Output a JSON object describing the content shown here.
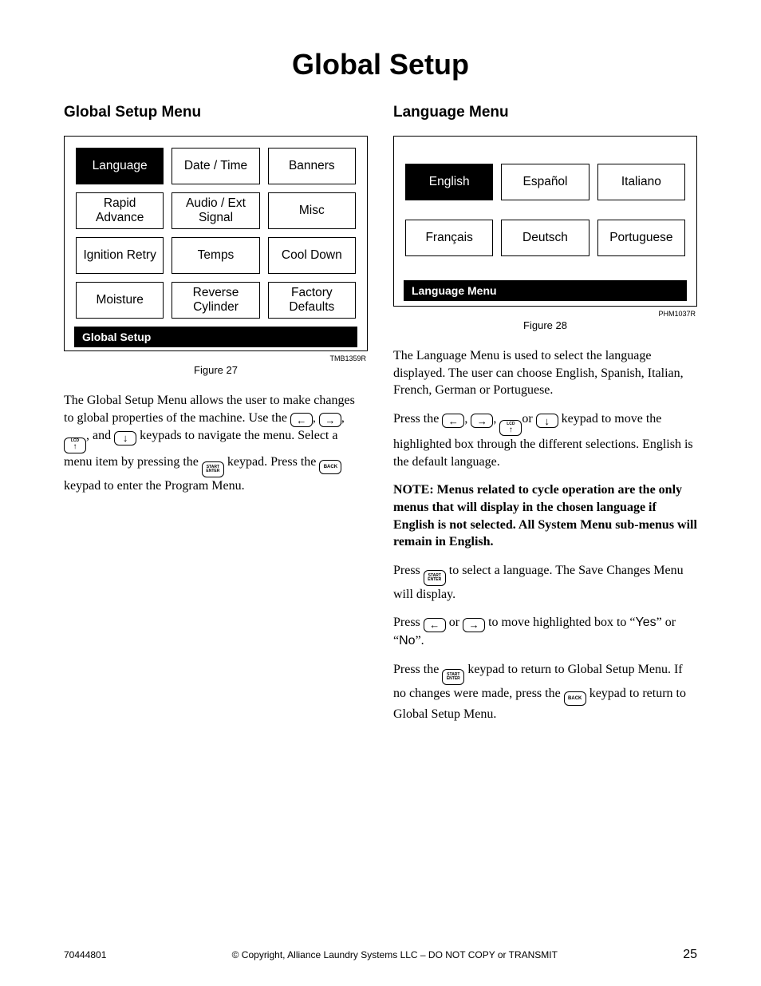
{
  "page_title": "Global Setup",
  "left": {
    "heading": "Global Setup Menu",
    "panel": {
      "cells": [
        {
          "label": "Language",
          "selected": true
        },
        {
          "label": "Date / Time",
          "selected": false
        },
        {
          "label": "Banners",
          "selected": false
        },
        {
          "label": "Rapid Advance",
          "selected": false
        },
        {
          "label": "Audio / Ext Signal",
          "selected": false
        },
        {
          "label": "Misc",
          "selected": false
        },
        {
          "label": "Ignition Retry",
          "selected": false
        },
        {
          "label": "Temps",
          "selected": false
        },
        {
          "label": "Cool Down",
          "selected": false
        },
        {
          "label": "Moisture",
          "selected": false
        },
        {
          "label": "Reverse Cylinder",
          "selected": false
        },
        {
          "label": "Factory Defaults",
          "selected": false
        }
      ],
      "titlebar": "Global Setup"
    },
    "imgcode": "TMB1359R",
    "figcaption": "Figure 27",
    "para1_a": "The Global Setup Menu allows the user to make changes to global properties of the machine. Use the ",
    "para1_b": ", ",
    "para1_c": ", ",
    "para1_d": ", and ",
    "para1_e": " keypads to navigate the menu. Select a menu item by pressing the ",
    "para1_f": " keypad. Press the ",
    "para1_g": " keypad to enter the Program Menu."
  },
  "right": {
    "heading": "Language Menu",
    "panel": {
      "cells": [
        {
          "label": "English",
          "selected": true
        },
        {
          "label": "Español",
          "selected": false
        },
        {
          "label": "Italiano",
          "selected": false
        },
        {
          "label": "Français",
          "selected": false
        },
        {
          "label": "Deutsch",
          "selected": false
        },
        {
          "label": "Portuguese",
          "selected": false
        }
      ],
      "titlebar": "Language Menu"
    },
    "imgcode": "PHM1037R",
    "figcaption": "Figure 28",
    "para1": "The Language Menu is used to select the language displayed. The user can choose English, Spanish, Italian, French, German or Portuguese.",
    "para2_a": "Press the ",
    "para2_b": ", ",
    "para2_c": ", ",
    "para2_d": "or ",
    "para2_e": " keypad to move the highlighted box through the different selections. English is the default language.",
    "note": "NOTE: Menus related to cycle operation are the only menus that will display in the chosen language if English is not selected. All System Menu sub-menus will remain in English.",
    "para4_a": "Press ",
    "para4_b": " to select a language. The Save Changes Menu will display.",
    "para5_a": "Press ",
    "para5_b": " or ",
    "para5_c": " to move highlighted box to “",
    "yes": "Yes",
    "para5_d": "” or “",
    "no": "No",
    "para5_e": "”.",
    "para6_a": "Press the ",
    "para6_b": " keypad to return to Global Setup Menu. If no changes were made, press the ",
    "para6_c": " keypad to return to Global Setup Menu."
  },
  "keys": {
    "left_arrow": "←",
    "right_arrow": "→",
    "up_arrow": "↑",
    "down_arrow": "↓",
    "lcd": "LCD",
    "start": "START",
    "enter": "ENTER",
    "back": "BACK"
  },
  "footer": {
    "docnum": "70444801",
    "copyright": "© Copyright, Alliance Laundry Systems LLC – DO NOT COPY or TRANSMIT",
    "pagenum": "25"
  }
}
